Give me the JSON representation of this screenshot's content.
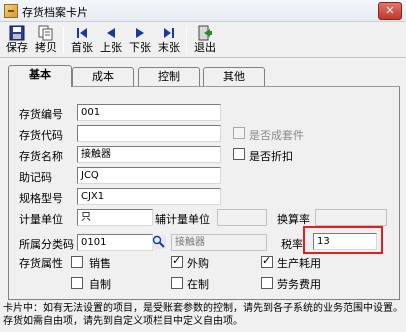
{
  "window": {
    "title": "存货档案卡片",
    "close_label": "✕"
  },
  "toolbar": {
    "buttons": [
      {
        "label": "保存",
        "icon": "save-icon"
      },
      {
        "label": "拷贝",
        "icon": "copy-icon"
      },
      {
        "label": "首张",
        "icon": "first-record-icon"
      },
      {
        "label": "上张",
        "icon": "previous-record-icon"
      },
      {
        "label": "下张",
        "icon": "next-record-icon"
      },
      {
        "label": "末张",
        "icon": "last-record-icon"
      },
      {
        "label": "退出",
        "icon": "exit-icon"
      }
    ]
  },
  "tabs": [
    {
      "label": "基本",
      "active": true
    },
    {
      "label": "成本",
      "active": false
    },
    {
      "label": "控制",
      "active": false
    },
    {
      "label": "其他",
      "active": false
    }
  ],
  "form": {
    "code_label": "存货编号",
    "code_value": "001",
    "inv_code_label": "存货代码",
    "inv_code_value": "",
    "name_label": "存货名称",
    "name_value": "接触器",
    "mnemonic_label": "助记码",
    "mnemonic_value": "JCQ",
    "spec_label": "规格型号",
    "spec_value": "CJX1",
    "unit_label": "计量单位",
    "unit_value": "只",
    "aux_unit_label": "辅计量单位",
    "aux_unit_value": "",
    "conversion_label": "换算率",
    "conversion_value": "",
    "category_label": "所属分类码",
    "category_code": "0101",
    "category_name": "接触器",
    "tax_label": "税率",
    "tax_value": "13",
    "attr_label": "存货属性",
    "is_kit_label": "是否成套件",
    "is_kit_checked": false,
    "is_discount_label": "是否折扣",
    "is_discount_checked": false,
    "attributes": [
      {
        "label": "销售",
        "checked": false
      },
      {
        "label": "外购",
        "checked": true
      },
      {
        "label": "生产耗用",
        "checked": true
      },
      {
        "label": "自制",
        "checked": false
      },
      {
        "label": "在制",
        "checked": false
      },
      {
        "label": "劳务费用",
        "checked": false
      }
    ]
  },
  "footer": {
    "text": "卡片中：如有无法设置的项目，是受账套参数的控制，请先到各子系统的业务范围中设置。存货如需自由项，请先到自定义项栏目中定义自由项。"
  }
}
